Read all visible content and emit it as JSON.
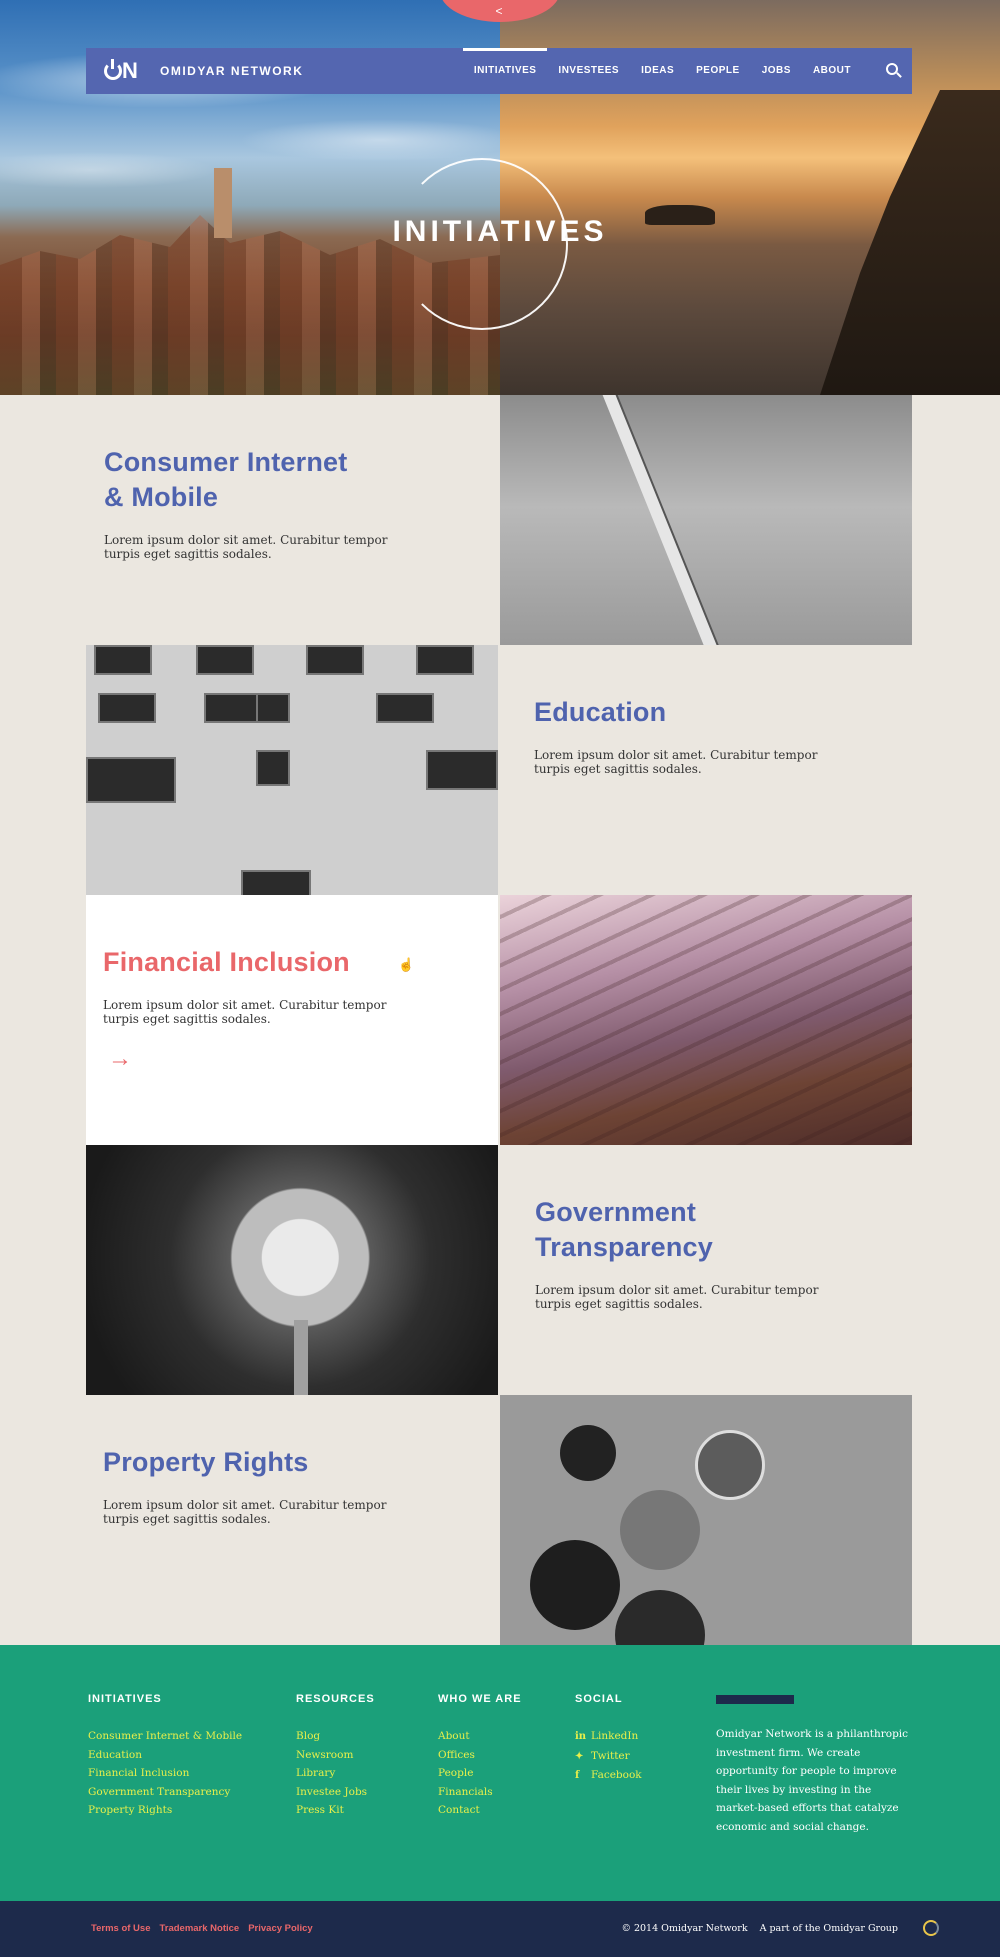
{
  "nav": {
    "logo": "ON",
    "brand": "OMIDYAR NETWORK",
    "items": [
      {
        "label": "INITIATIVES"
      },
      {
        "label": "INVESTEES"
      },
      {
        "label": "IDEAS"
      },
      {
        "label": "PEOPLE"
      },
      {
        "label": "JOBS"
      },
      {
        "label": "ABOUT"
      }
    ]
  },
  "hero": {
    "title": "INITIATIVES"
  },
  "initiatives": [
    {
      "title_line1": "Consumer Internet",
      "title_line2": "& Mobile",
      "body": "Lorem ipsum dolor sit amet. Curabitur tempor turpis eget sagittis sodales."
    },
    {
      "title_line1": "Education",
      "title_line2": "",
      "body": "Lorem ipsum dolor sit amet. Curabitur tempor turpis eget sagittis sodales."
    },
    {
      "title_line1": "Financial Inclusion",
      "title_line2": "",
      "body": "Lorem ipsum dolor sit amet. Curabitur tempor turpis eget sagittis sodales."
    },
    {
      "title_line1": "Government",
      "title_line2": "Transparency",
      "body": "Lorem ipsum dolor sit amet. Curabitur tempor turpis eget sagittis sodales."
    },
    {
      "title_line1": "Property Rights",
      "title_line2": "",
      "body": "Lorem ipsum dolor sit amet. Curabitur tempor turpis eget sagittis sodales."
    }
  ],
  "footer": {
    "initiatives": {
      "heading": "INITIATIVES",
      "links": [
        "Consumer Internet & Mobile",
        "Education",
        "Financial Inclusion",
        "Government Transparency",
        "Property Rights"
      ]
    },
    "resources": {
      "heading": "RESOURCES",
      "links": [
        "Blog",
        "Newsroom",
        "Library",
        "Investee Jobs",
        "Press Kit"
      ]
    },
    "who": {
      "heading": "WHO WE ARE",
      "links": [
        "About",
        "Offices",
        "People",
        "Financials",
        "Contact"
      ]
    },
    "social": {
      "heading": "SOCIAL",
      "links": [
        "LinkedIn",
        "Twitter",
        "Facebook"
      ]
    },
    "blurb": "Omidyar Network is a philanthropic investment firm. We create opportunity for people to improve their lives by investing in the market-based efforts that catalyze economic and social change."
  },
  "bottom": {
    "legal": [
      "Terms of Use",
      "Trademark Notice",
      "Privacy Policy"
    ],
    "copyright": "© 2014 Omidyar Network",
    "group": "A part of the Omidyar Group"
  },
  "colors": {
    "nav": "#5466b0",
    "accent": "#e9676a",
    "footer": "#1ba07a",
    "bottom": "#1d2a4b",
    "link": "#e8ef4a",
    "title": "#4f63ae"
  },
  "icons": [
    "share-icon",
    "search-icon",
    "arrow-right-icon",
    "linkedin-icon",
    "twitter-icon",
    "facebook-icon",
    "omidyar-group-logo"
  ]
}
